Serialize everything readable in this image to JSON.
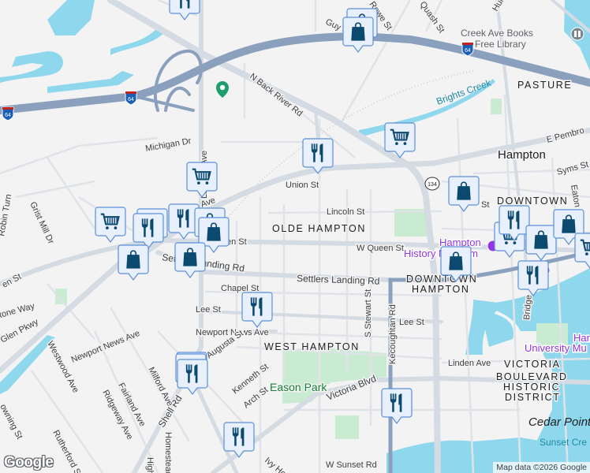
{
  "map": {
    "colors": {
      "land": "#f4f3f4",
      "water": "#8fd7ec",
      "park": "#c9ebd2",
      "highway": "#8aa0bc",
      "arterial": "#d4dbe3",
      "minor": "#dfe3e8",
      "marker_fill": "#e8f0fe",
      "marker_icon": "#0b4a6e"
    },
    "streets": {
      "guy": "Guy St",
      "rowe": "Rowe St",
      "quash": "Quash St",
      "hun": "Hun",
      "n_back_river": "N Back River Rd",
      "la_salle": "La Salle Ave",
      "michigan": "Michigan Dr",
      "union": "Union St",
      "pembroke_e": "E Pembro",
      "syms": "Syms St",
      "eaton": "Eaton",
      "lincoln": "Lincoln St",
      "w_queen": "W Queen St",
      "queen_left": "en St",
      "queen_mid": "en St",
      "settlers": "Settlers Landing Rd",
      "settlers_left": "Settlers Landing Rd",
      "chapel": "Chapel St",
      "lee_left": "Lee St",
      "lee_right": "Lee St",
      "newport_news_1": "Newport News Ave",
      "newport_news_2": "Newport News Ave",
      "augusta": "Augusta St",
      "kenneth": "Kenneth St",
      "arch": "Arch St",
      "victoria": "Victoria Blvd",
      "linden": "Linden Ave",
      "s_stewart": "S Stewart St",
      "kecoughtan": "Kecoughtan Rd",
      "w_sunset": "W Sunset Rd",
      "ivy_home": "Ivy Home",
      "bridge": "Bridge",
      "shell": "Shell Rd",
      "milford": "Milford Ave",
      "fairland": "Fairland Ave",
      "ridgeway": "Ridgeway Ave",
      "westwood": "Westwood Ave",
      "rutherford": "Rutherford St",
      "downing": "owning St",
      "homestead": "Homestead",
      "high": "High",
      "glen_pkwy": "Glen Pkwy",
      "stone_way": "tone Way",
      "grist_mill": "Grist Mill Dr",
      "robin_turn": "Robin Turn",
      "pembroke_ave": "Ave",
      "st_right": "St"
    },
    "highway_shields": [
      "64",
      "64",
      "64"
    ],
    "route_shield": "134",
    "neighborhoods": {
      "pasture": "PASTURE",
      "downtown_top": "DOWNTOWN",
      "olde_hampton": "OLDE HAMPTON",
      "downtown_hampton_1": "DOWNTOWN",
      "downtown_hampton_2": "HAMPTON",
      "west_hampton": "WEST HAMPTON",
      "victoria_1": "VICTORIA",
      "victoria_2": "BOULEVARD",
      "victoria_3": "HISTORIC",
      "victoria_4": "DISTRICT"
    },
    "city": "Hampton",
    "pois": {
      "creek_books_1": "Creek Ave Books",
      "creek_books_2": "Free Library",
      "history_museum_1": "Hampton",
      "history_museum_2": "History Museum",
      "university_museum_1": "Hampton",
      "university_museum_2": "University Mu"
    },
    "parks": {
      "eason": "Eason Park"
    },
    "waters": {
      "brights_creek": "Brights Creek",
      "sunset_creek": "Sunset Cre",
      "cedar_point": "Cedar Point"
    },
    "markers": [
      "restaurant",
      "shopping",
      "shopping",
      "restaurant",
      "grocery",
      "grocery",
      "grocery",
      "restaurant",
      "restaurant",
      "restaurant",
      "shopping",
      "shopping",
      "shopping",
      "shopping",
      "restaurant",
      "restaurant",
      "grocery",
      "restaurant",
      "shopping",
      "grocery",
      "restaurant",
      "shopping",
      "shopping",
      "shopping",
      "grocery",
      "restaurant",
      "restaurant",
      "restaurant"
    ],
    "attribution": "Map data ©2026 Google",
    "logo": "Google"
  }
}
